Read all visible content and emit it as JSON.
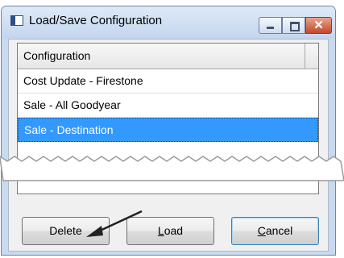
{
  "window": {
    "title": "Load/Save Configuration"
  },
  "list": {
    "column_header": "Configuration",
    "items": [
      {
        "label": "Cost Update - Firestone",
        "selected": false
      },
      {
        "label": "Sale - All Goodyear",
        "selected": false
      },
      {
        "label": "Sale - Destination",
        "selected": true
      }
    ]
  },
  "buttons": {
    "delete": "Delete",
    "load_prefix": "",
    "load_mnemonic": "L",
    "load_rest": "oad",
    "cancel_prefix": "",
    "cancel_mnemonic": "C",
    "cancel_rest": "ancel"
  },
  "colors": {
    "selection": "#3399ff",
    "titlebar": "#c9daf0",
    "close_button": "#c44729"
  },
  "icons": {
    "app": "window-icon",
    "minimize": "minimize-icon",
    "maximize": "maximize-icon",
    "close": "close-icon",
    "callout": "arrow-icon"
  }
}
